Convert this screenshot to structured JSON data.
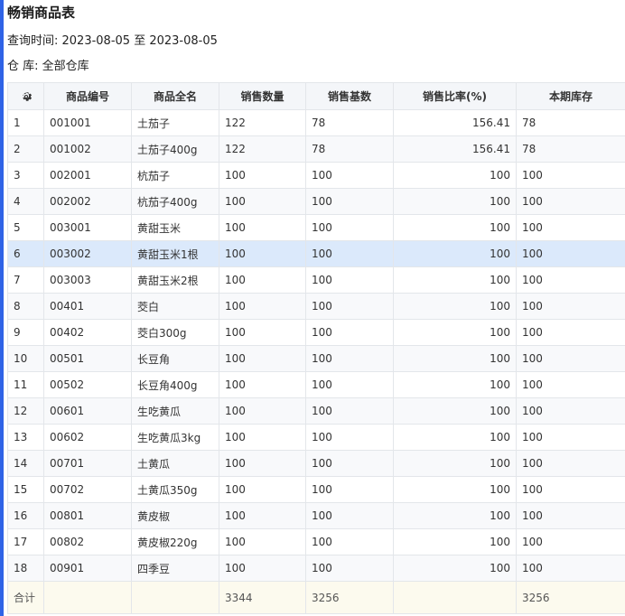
{
  "report": {
    "title": "畅销商品表",
    "query_time": "查询时间: 2023-08-05 至 2023-08-05",
    "warehouse": "仓 库: 全部仓库"
  },
  "table": {
    "headers": [
      "商品编号",
      "商品全名",
      "销售数量",
      "销售基数",
      "销售比率(%)",
      "本期库存"
    ],
    "rows": [
      [
        "1",
        "001001",
        "土茄子",
        "122",
        "78",
        "156.41",
        "78"
      ],
      [
        "2",
        "001002",
        "土茄子400g",
        "122",
        "78",
        "156.41",
        "78"
      ],
      [
        "3",
        "002001",
        "杭茄子",
        "100",
        "100",
        "100",
        "100"
      ],
      [
        "4",
        "002002",
        "杭茄子400g",
        "100",
        "100",
        "100",
        "100"
      ],
      [
        "5",
        "003001",
        "黄甜玉米",
        "100",
        "100",
        "100",
        "100"
      ],
      [
        "6",
        "003002",
        "黄甜玉米1根",
        "100",
        "100",
        "100",
        "100"
      ],
      [
        "7",
        "003003",
        "黄甜玉米2根",
        "100",
        "100",
        "100",
        "100"
      ],
      [
        "8",
        "00401",
        "茭白",
        "100",
        "100",
        "100",
        "100"
      ],
      [
        "9",
        "00402",
        "茭白300g",
        "100",
        "100",
        "100",
        "100"
      ],
      [
        "10",
        "00501",
        "长豆角",
        "100",
        "100",
        "100",
        "100"
      ],
      [
        "11",
        "00502",
        "长豆角400g",
        "100",
        "100",
        "100",
        "100"
      ],
      [
        "12",
        "00601",
        "生吃黄瓜",
        "100",
        "100",
        "100",
        "100"
      ],
      [
        "13",
        "00602",
        "生吃黄瓜3kg",
        "100",
        "100",
        "100",
        "100"
      ],
      [
        "14",
        "00701",
        "土黄瓜",
        "100",
        "100",
        "100",
        "100"
      ],
      [
        "15",
        "00702",
        "土黄瓜350g",
        "100",
        "100",
        "100",
        "100"
      ],
      [
        "16",
        "00801",
        "黄皮椒",
        "100",
        "100",
        "100",
        "100"
      ],
      [
        "17",
        "00802",
        "黄皮椒220g",
        "100",
        "100",
        "100",
        "100"
      ],
      [
        "18",
        "00901",
        "四季豆",
        "100",
        "100",
        "100",
        "100"
      ]
    ],
    "selected_row": 6,
    "footer": {
      "label": "合计",
      "sales_qty": "3344",
      "sales_base": "3256",
      "stock": "3256"
    }
  },
  "colors": {
    "accent": "#2f63e6",
    "selected_row": "#dbe9fb",
    "header_bg": "#f4f6f9"
  }
}
